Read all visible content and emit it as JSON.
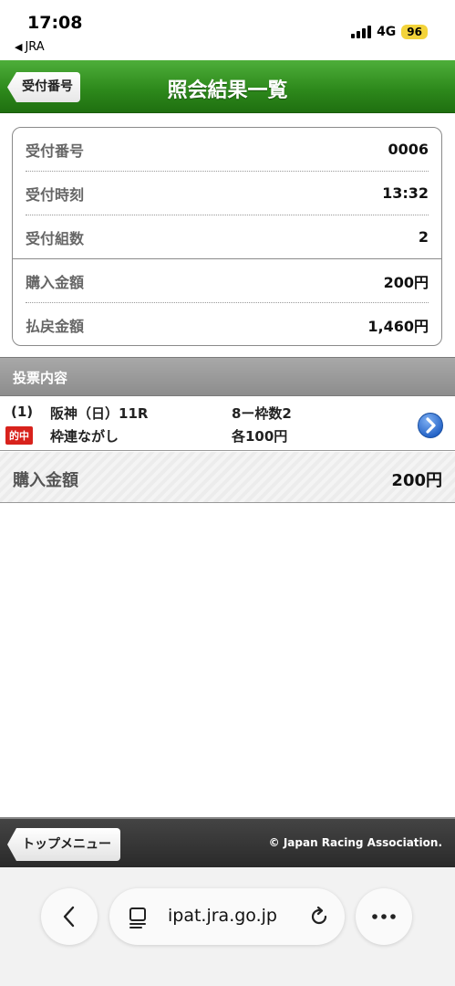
{
  "status": {
    "time": "17:08",
    "back_app": "JRA",
    "network": "4G",
    "battery": "96"
  },
  "header": {
    "back_label": "受付番号",
    "title": "照会結果一覧"
  },
  "receipt": {
    "rows": [
      {
        "label": "受付番号",
        "value": "0006"
      },
      {
        "label": "受付時刻",
        "value": "13:32"
      },
      {
        "label": "受付組数",
        "value": "2"
      },
      {
        "label": "購入金額",
        "value": "200円"
      },
      {
        "label": "払戻金額",
        "value": "1,460円"
      }
    ]
  },
  "section": {
    "title": "投票内容"
  },
  "bet": {
    "number": "(1)",
    "race": "阪神（日）11R",
    "hit_badge": "的中",
    "bet_type": "枠連ながし",
    "combination": "8ー枠数2",
    "amount": "各100円"
  },
  "purchase_total": {
    "label": "購入金額",
    "value": "200円"
  },
  "footer": {
    "top_menu_label": "トップメニュー",
    "copyright": "© Japan Racing Association."
  },
  "browser": {
    "url": "ipat.jra.go.jp"
  },
  "colors": {
    "header_green": "#2e8a1c",
    "hit_red": "#d8221c",
    "arrow_blue": "#2a6fd6",
    "battery_yellow": "#f3d33a"
  }
}
